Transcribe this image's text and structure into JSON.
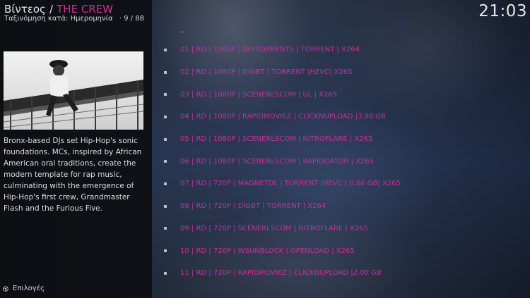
{
  "header": {
    "section": "Βίντεος",
    "separator": "/",
    "title": "THE CREW",
    "sort_label": "Ταξινόμηση κατά: Ημερομηνία",
    "count": "9 / 88"
  },
  "clock": "21:03",
  "plot": "Bronx-based DJs set Hip-Hop's sonic foundations. MCs, inspired by African American oral traditions, create the modern template for rap music, culminating with the emergence of Hip-Hop's first crew, Grandmaster Flash and the Furious Five.",
  "options_label": "Επιλογές",
  "list": {
    "parent_label": "..",
    "items": [
      {
        "text": "01 | RD | 1080P | SKYTORRENTS | TORRENT |  X264",
        "extra": ""
      },
      {
        "text": "02 | RD | 1080P | DIGBT | TORRENT | ",
        "extra": "HEVC",
        "tail": " |  X265"
      },
      {
        "text": "03 | RD | 1080P | SCENERLSCOM | UL |  X265",
        "extra": ""
      },
      {
        "text": "04 | RD | 1080P | RAPIDMOVIEZ | CLICKNUPLOAD | ",
        "extra": "3.90 GB",
        "tail": ""
      },
      {
        "text": "05 | RD | 1080P | SCENERLSCOM | NITROFLARE |  X265",
        "extra": ""
      },
      {
        "text": "06 | RD | 1080P | SCENERLSCOM | RAPIDGATOR |  X265",
        "extra": ""
      },
      {
        "text": "07 | RD | 720P | MAGNETDL | TORRENT | ",
        "extra": "HEVC | 0.66 GB",
        "tail": " |  X265"
      },
      {
        "text": "08 | RD | 720P | DIGBT | TORRENT |  X264",
        "extra": ""
      },
      {
        "text": "09 | RD | 720P | SCENERLSCOM | NITROFLARE |  X265",
        "extra": ""
      },
      {
        "text": "10 | RD | 720P | WSUNBLOCK | OPENLOAD |  X265",
        "extra": ""
      },
      {
        "text": "11 | RD | 720P | RAPIDMOVIEZ | CLICKNUPLOAD | ",
        "extra": "2.00 GB",
        "tail": ""
      }
    ]
  },
  "colors": {
    "accent": "#d12f8c",
    "item_text": "#c2319a"
  },
  "icons": {
    "options": "gear-icon",
    "bullet": "square-bullet-icon"
  }
}
